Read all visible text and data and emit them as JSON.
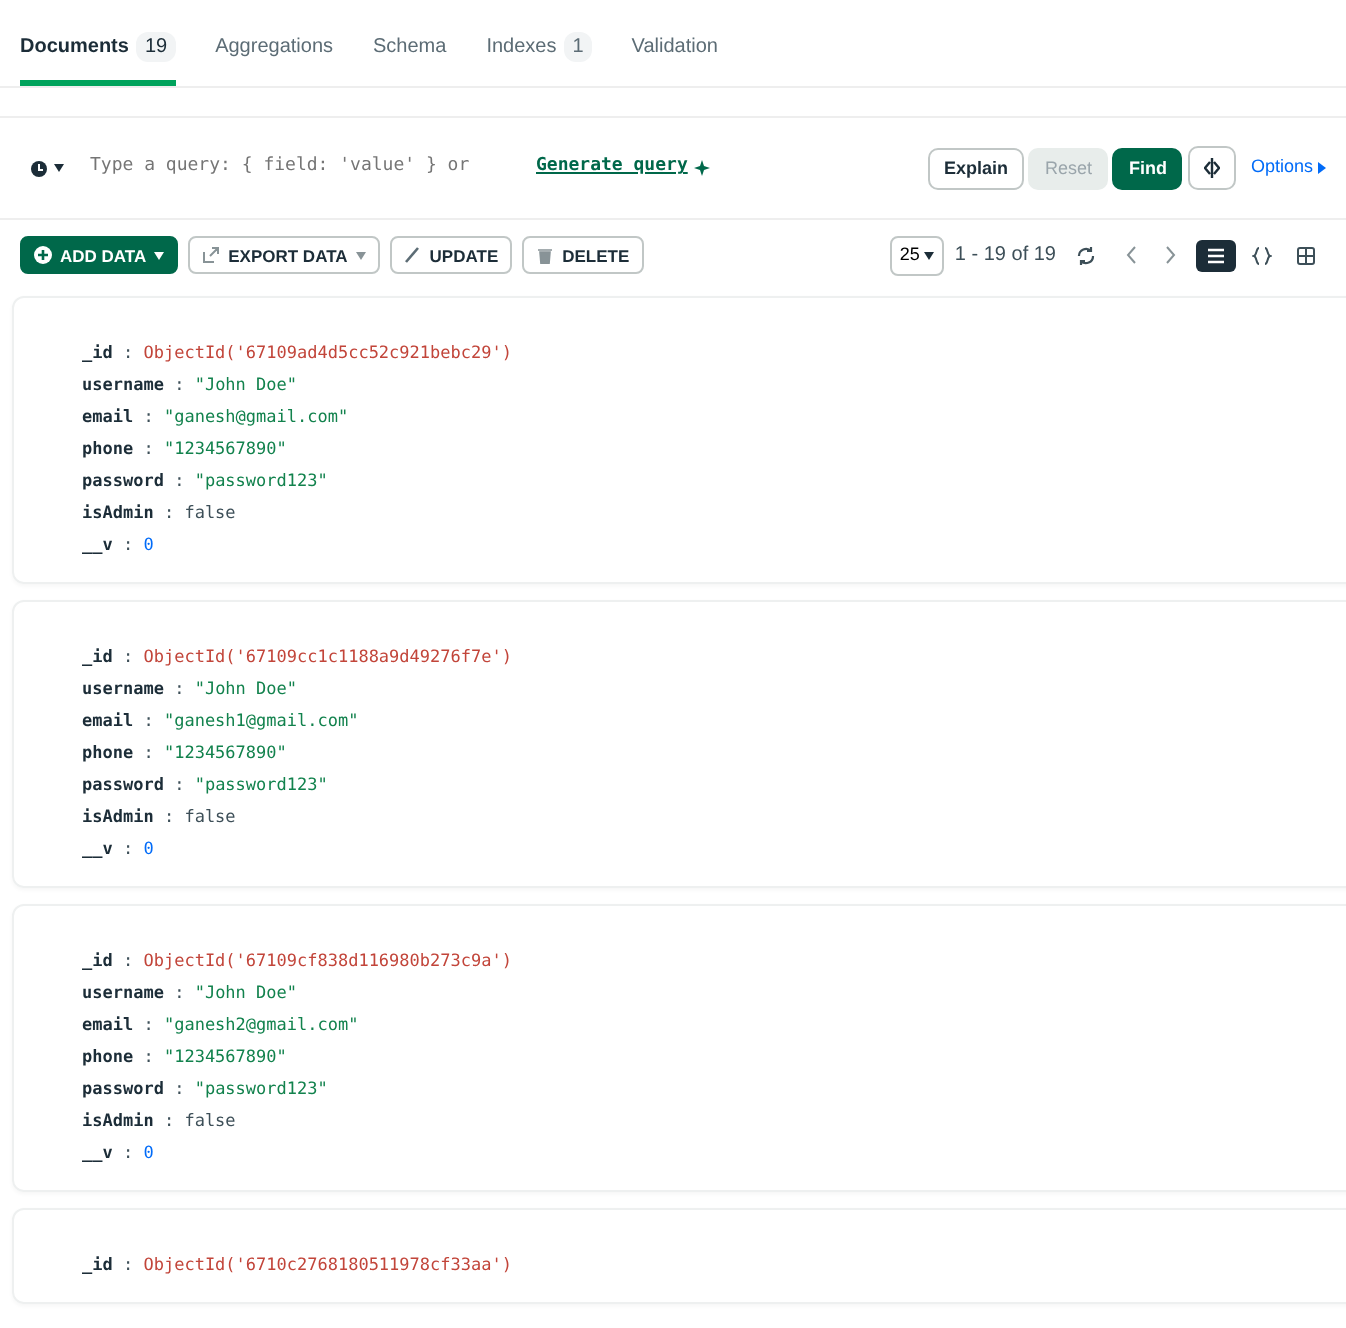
{
  "tabs": [
    {
      "label": "Documents",
      "count": "19",
      "selected": true
    },
    {
      "label": "Aggregations",
      "selected": false
    },
    {
      "label": "Schema",
      "selected": false
    },
    {
      "label": "Indexes",
      "count": "1",
      "selected": false
    },
    {
      "label": "Validation",
      "selected": false
    }
  ],
  "query": {
    "placeholder": "Type a query: { field: 'value' } or",
    "generate_link": "Generate query",
    "buttons": [
      {
        "label": "Explain",
        "kind": "outline",
        "disabled": false
      },
      {
        "label": "Reset",
        "kind": "outline",
        "disabled": true
      },
      {
        "label": "Find",
        "kind": "primary",
        "disabled": false
      }
    ],
    "options": "Options"
  },
  "toolbar": {
    "buttons": [
      {
        "label": "ADD DATA",
        "kind": "add"
      },
      {
        "label": "EXPORT DATA",
        "kind": "export"
      },
      {
        "label": "UPDATE",
        "kind": "update"
      },
      {
        "label": "DELETE",
        "kind": "delete"
      }
    ],
    "page_size": "25",
    "range": "1 - 19 of 19",
    "views": [
      {
        "kind": "list",
        "selected": true
      },
      {
        "kind": "json",
        "selected": false
      },
      {
        "kind": "table",
        "selected": false
      }
    ]
  },
  "documents": [
    {
      "fields": [
        {
          "key": "_id",
          "sep": ":",
          "value": "ObjectId('67109ad4d5cc52c921bebc29')",
          "kind": "objectid"
        },
        {
          "key": "username",
          "sep": ":",
          "value": "\"John Doe\"",
          "kind": "string"
        },
        {
          "key": "email",
          "sep": ":",
          "value": "\"ganesh@gmail.com\"",
          "kind": "string"
        },
        {
          "key": "phone",
          "sep": ":",
          "value": "\"1234567890\"",
          "kind": "string"
        },
        {
          "key": "password",
          "sep": ":",
          "value": "\"password123\"",
          "kind": "string"
        },
        {
          "key": "isAdmin",
          "sep": ":",
          "value": "false",
          "kind": "boolean"
        },
        {
          "key": "__v",
          "sep": ":",
          "value": "0",
          "kind": "number"
        }
      ]
    },
    {
      "fields": [
        {
          "key": "_id",
          "sep": ":",
          "value": "ObjectId('67109cc1c1188a9d49276f7e')",
          "kind": "objectid"
        },
        {
          "key": "username",
          "sep": ":",
          "value": "\"John Doe\"",
          "kind": "string"
        },
        {
          "key": "email",
          "sep": ":",
          "value": "\"ganesh1@gmail.com\"",
          "kind": "string"
        },
        {
          "key": "phone",
          "sep": ":",
          "value": "\"1234567890\"",
          "kind": "string"
        },
        {
          "key": "password",
          "sep": ":",
          "value": "\"password123\"",
          "kind": "string"
        },
        {
          "key": "isAdmin",
          "sep": ":",
          "value": "false",
          "kind": "boolean"
        },
        {
          "key": "__v",
          "sep": ":",
          "value": "0",
          "kind": "number"
        }
      ]
    },
    {
      "fields": [
        {
          "key": "_id",
          "sep": ":",
          "value": "ObjectId('67109cf838d116980b273c9a')",
          "kind": "objectid"
        },
        {
          "key": "username",
          "sep": ":",
          "value": "\"John Doe\"",
          "kind": "string"
        },
        {
          "key": "email",
          "sep": ":",
          "value": "\"ganesh2@gmail.com\"",
          "kind": "string"
        },
        {
          "key": "phone",
          "sep": ":",
          "value": "\"1234567890\"",
          "kind": "string"
        },
        {
          "key": "password",
          "sep": ":",
          "value": "\"password123\"",
          "kind": "string"
        },
        {
          "key": "isAdmin",
          "sep": ":",
          "value": "false",
          "kind": "boolean"
        },
        {
          "key": "__v",
          "sep": ":",
          "value": "0",
          "kind": "number"
        }
      ]
    },
    {
      "fields": [
        {
          "key": "_id",
          "sep": ":",
          "value": "ObjectId('6710c2768180511978cf33aa')",
          "kind": "objectid"
        }
      ]
    }
  ]
}
